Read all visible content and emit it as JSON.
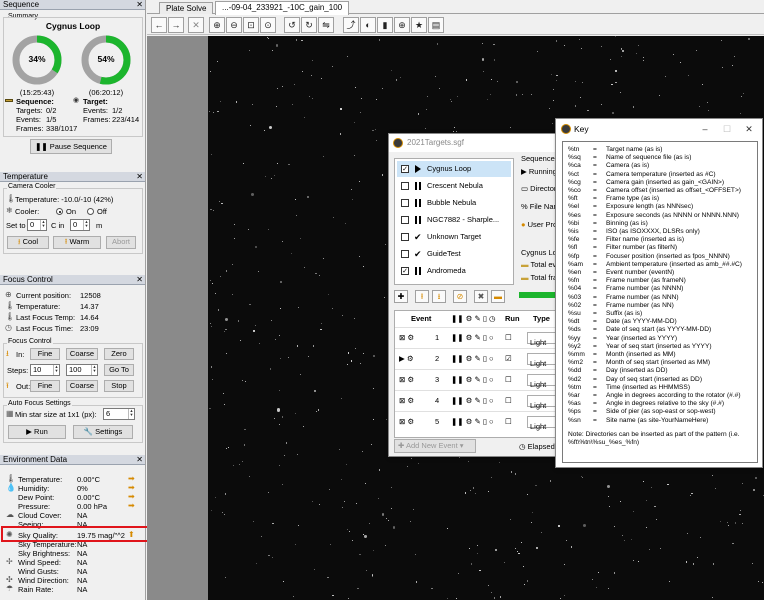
{
  "sequence_panel": {
    "title": "Sequence",
    "summary_label": "Summary",
    "target_name": "Cygnus Loop",
    "left_ring": {
      "percent_label": "34%",
      "progress": 0.34,
      "time": "(15:25:43)"
    },
    "right_ring": {
      "percent_label": "54%",
      "progress": 0.54,
      "time": "(06:20:12)"
    },
    "sequence_header": "Sequence:",
    "target_header": "Target:",
    "seq_targets_label": "Targets:",
    "seq_targets_value": "0/2",
    "seq_events_label": "Events:",
    "seq_events_value": "1/5",
    "seq_frames_label": "Frames:",
    "seq_frames_value": "338/1017",
    "tgt_events_label": "Events:",
    "tgt_events_value": "1/2",
    "tgt_frames_label": "Frames:",
    "tgt_frames_value": "223/414",
    "pause_button": "Pause Sequence"
  },
  "temperature_panel": {
    "title": "Temperature",
    "group_label": "Camera Cooler",
    "temperature_text": "Temperature: -10.0/-10 (42%)",
    "cooler_label": "Cooler:",
    "on_label": "On",
    "off_label": "Off",
    "set_to_label": "Set to",
    "set_value": "0",
    "c_in_label": "C in",
    "minutes_value": "0",
    "m_label": "m",
    "cool_button": "Cool",
    "warm_button": "Warm",
    "abort_button": "Abort"
  },
  "focus_panel": {
    "title": "Focus Control",
    "current_position_label": "Current position:",
    "current_position_value": "12508",
    "temperature_label": "Temperature:",
    "temperature_value": "14.37",
    "last_focus_temp_label": "Last Focus Temp:",
    "last_focus_temp_value": "14.64",
    "last_focus_time_label": "Last Focus Time:",
    "last_focus_time_value": "23:09",
    "group_label": "Focus Control",
    "in_label": "In:",
    "fine_label": "Fine",
    "coarse_label": "Coarse",
    "zero_label": "Zero",
    "steps_label": "Steps:",
    "steps_fine_value": "10",
    "steps_coarse_value": "100",
    "goto_label": "Go To",
    "out_label": "Out:",
    "stop_label": "Stop",
    "auto_group_label": "Auto Focus Settings",
    "min_star_label": "Min star size at 1x1 (px):",
    "min_star_value": "6",
    "run_button": "Run",
    "settings_button": "Settings"
  },
  "environment_panel": {
    "title": "Environment Data",
    "rows": [
      {
        "label": "Temperature:",
        "value": "0.00°C"
      },
      {
        "label": "Humidity:",
        "value": "0%"
      },
      {
        "label": "Dew Point:",
        "value": "0.00°C"
      },
      {
        "label": "Pressure:",
        "value": "0.00 hPa"
      },
      {
        "label": "Cloud Cover:",
        "value": "NA"
      },
      {
        "label": "Seeing:",
        "value": "NA"
      },
      {
        "label": "Sky Quality:",
        "value": "19.75 mag/\"^2"
      },
      {
        "label": "Sky Temperature:",
        "value": "NA"
      },
      {
        "label": "Sky Brightness:",
        "value": "NA"
      },
      {
        "label": "Wind Speed:",
        "value": "NA"
      },
      {
        "label": "Wind Gusts:",
        "value": "NA"
      },
      {
        "label": "Wind Direction:",
        "value": "NA"
      },
      {
        "label": "Rain Rate:",
        "value": "NA"
      }
    ]
  },
  "tabs": [
    {
      "label": "Plate Solve"
    },
    {
      "label": "...-09-04_233921_-10C_gain_100"
    }
  ],
  "targets_dialog": {
    "title": "2021Targets.sgf",
    "targets": [
      {
        "name": "Cygnus Loop"
      },
      {
        "name": "Crescent Nebula"
      },
      {
        "name": "Bubble Nebula"
      },
      {
        "name": "NGC7882 - Sharple..."
      },
      {
        "name": "Unknown Target"
      },
      {
        "name": "GuideTest"
      },
      {
        "name": "Andromeda"
      }
    ],
    "seq_labels": [
      "Sequence",
      "Running",
      "Director",
      "File Nan",
      "User Pro",
      "Cygnus Loo",
      "Total eve",
      "Total fra"
    ],
    "event_header": "Event",
    "run_header": "Run",
    "type_header": "Type",
    "events": [
      {
        "num": "1",
        "type": "Light"
      },
      {
        "num": "2",
        "type": "Light"
      },
      {
        "num": "3",
        "type": "Light"
      },
      {
        "num": "4",
        "type": "Light"
      },
      {
        "num": "5",
        "type": "Light"
      }
    ],
    "add_event_button": "Add New Event",
    "elapsed_label": "Elapsed"
  },
  "key_window": {
    "title": "Key",
    "rows": [
      {
        "code": "%tn",
        "eq": "=",
        "desc": "Target name (as is)"
      },
      {
        "code": "%sq",
        "eq": "=",
        "desc": "Name of sequence file (as is)"
      },
      {
        "code": "%ca",
        "eq": "=",
        "desc": "Camera (as is)"
      },
      {
        "code": "%ct",
        "eq": "=",
        "desc": "Camera temperature (inserted as #C)"
      },
      {
        "code": "%cg",
        "eq": "=",
        "desc": "Camera gain (inserted as gain_<GAIN>)"
      },
      {
        "code": "%co",
        "eq": "=",
        "desc": "Camera offset (inserted as offset_<OFFSET>)"
      },
      {
        "code": "%ft",
        "eq": "=",
        "desc": "Frame type (as is)"
      },
      {
        "code": "%el",
        "eq": "=",
        "desc": "Exposure length (as NNNsec)"
      },
      {
        "code": "%es",
        "eq": "=",
        "desc": "Exposure seconds (as NNNN or NNNN.NNN)"
      },
      {
        "code": "%bi",
        "eq": "=",
        "desc": "Binning (as is)"
      },
      {
        "code": "%is",
        "eq": "=",
        "desc": "ISO (as ISOXXXX, DLSRs only)"
      },
      {
        "code": "%fe",
        "eq": "=",
        "desc": "Filter name (inserted as is)"
      },
      {
        "code": "%fl",
        "eq": "=",
        "desc": "Filter number (as filterN)"
      },
      {
        "code": "%fp",
        "eq": "=",
        "desc": "Focuser position (inserted as fpos_NNNN)"
      },
      {
        "code": "%am",
        "eq": "=",
        "desc": "Ambient temperature (inserted as amb_##.#C)"
      },
      {
        "code": "%en",
        "eq": "=",
        "desc": "Event number (eventN)"
      },
      {
        "code": "%fn",
        "eq": "=",
        "desc": "Frame number (as frameN)"
      },
      {
        "code": "%04",
        "eq": "=",
        "desc": "Frame number (as NNNN)"
      },
      {
        "code": "%03",
        "eq": "=",
        "desc": "Frame number (as NNN)"
      },
      {
        "code": "%02",
        "eq": "=",
        "desc": "Frame number (as NN)"
      },
      {
        "code": "%su",
        "eq": "=",
        "desc": "Suffix (as is)"
      },
      {
        "code": "%dt",
        "eq": "=",
        "desc": "Date (as YYYY-MM-DD)"
      },
      {
        "code": "%ds",
        "eq": "=",
        "desc": "Date of seq start (as YYYY-MM-DD)"
      },
      {
        "code": "%yy",
        "eq": "=",
        "desc": "Year (inserted as YYYY)"
      },
      {
        "code": "%y2",
        "eq": "=",
        "desc": "Year of seq start (inserted as YYYY)"
      },
      {
        "code": "%mm",
        "eq": "=",
        "desc": "Month (inserted as MM)"
      },
      {
        "code": "%m2",
        "eq": "=",
        "desc": "Month of seq start (inserted as MM)"
      },
      {
        "code": "%dd",
        "eq": "=",
        "desc": "Day (inserted as DD)"
      },
      {
        "code": "%d2",
        "eq": "=",
        "desc": "Day of seq start (inserted as DD)"
      },
      {
        "code": "%tm",
        "eq": "=",
        "desc": "Time (inserted as HHMMSS)"
      },
      {
        "code": "%ar",
        "eq": "=",
        "desc": "Angle in degrees according to the rotator (#.#)"
      },
      {
        "code": "%as",
        "eq": "=",
        "desc": "Angle in degrees relative to the sky (#.#)"
      },
      {
        "code": "%ps",
        "eq": "=",
        "desc": "Side of pier (as sop-east or sop-west)"
      },
      {
        "code": "%sn",
        "eq": "=",
        "desc": "Site name (as site-YourNameHere)"
      }
    ],
    "note": "Note: Directories can be inserted as part of the pattern (i.e. %ft\\%tn\\%su_%es_%fn)"
  },
  "colors": {
    "ring_fill": "#1cb52d",
    "ring_track": "#a3a3a3",
    "highlight_border": "#e0151b",
    "selection": "#cce4f7"
  }
}
